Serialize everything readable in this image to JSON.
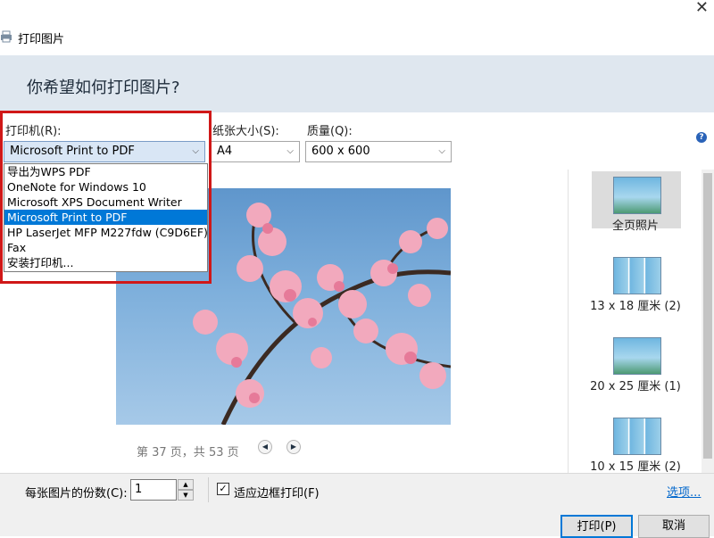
{
  "window": {
    "title": "打印图片"
  },
  "header": {
    "question": "你希望如何打印图片?"
  },
  "printer": {
    "label": "打印机(R):",
    "selected": "Microsoft Print to PDF",
    "options": [
      "导出为WPS PDF",
      "OneNote for Windows 10",
      "Microsoft XPS Document Writer",
      "Microsoft Print to PDF",
      "HP LaserJet MFP M227fdw (C9D6EF)",
      "Fax",
      "安装打印机..."
    ],
    "selected_index": 3
  },
  "paper": {
    "label": "纸张大小(S):",
    "value": "A4"
  },
  "quality": {
    "label": "质量(Q):",
    "value": "600 x 600"
  },
  "help_icon_glyph": "?",
  "preview": {
    "page_info": "第 37 页，共 53 页"
  },
  "layouts": [
    {
      "label": "全页照片",
      "icon": "single-photo-thumb",
      "selected": true
    },
    {
      "label": "13 x 18 厘米 (2)",
      "icon": "split-photo-thumb"
    },
    {
      "label": "20 x 25 厘米 (1)",
      "icon": "single-photo-thumb"
    },
    {
      "label": "10 x 15 厘米 (2)",
      "icon": "split-photo-thumb"
    }
  ],
  "copies": {
    "label": "每张图片的份数(C):",
    "value": "1"
  },
  "fit_frame": {
    "label": "适应边框打印(F)",
    "checked": true,
    "check_glyph": "✓"
  },
  "options_link": "选项...",
  "buttons": {
    "print": "打印(P)",
    "cancel": "取消"
  }
}
